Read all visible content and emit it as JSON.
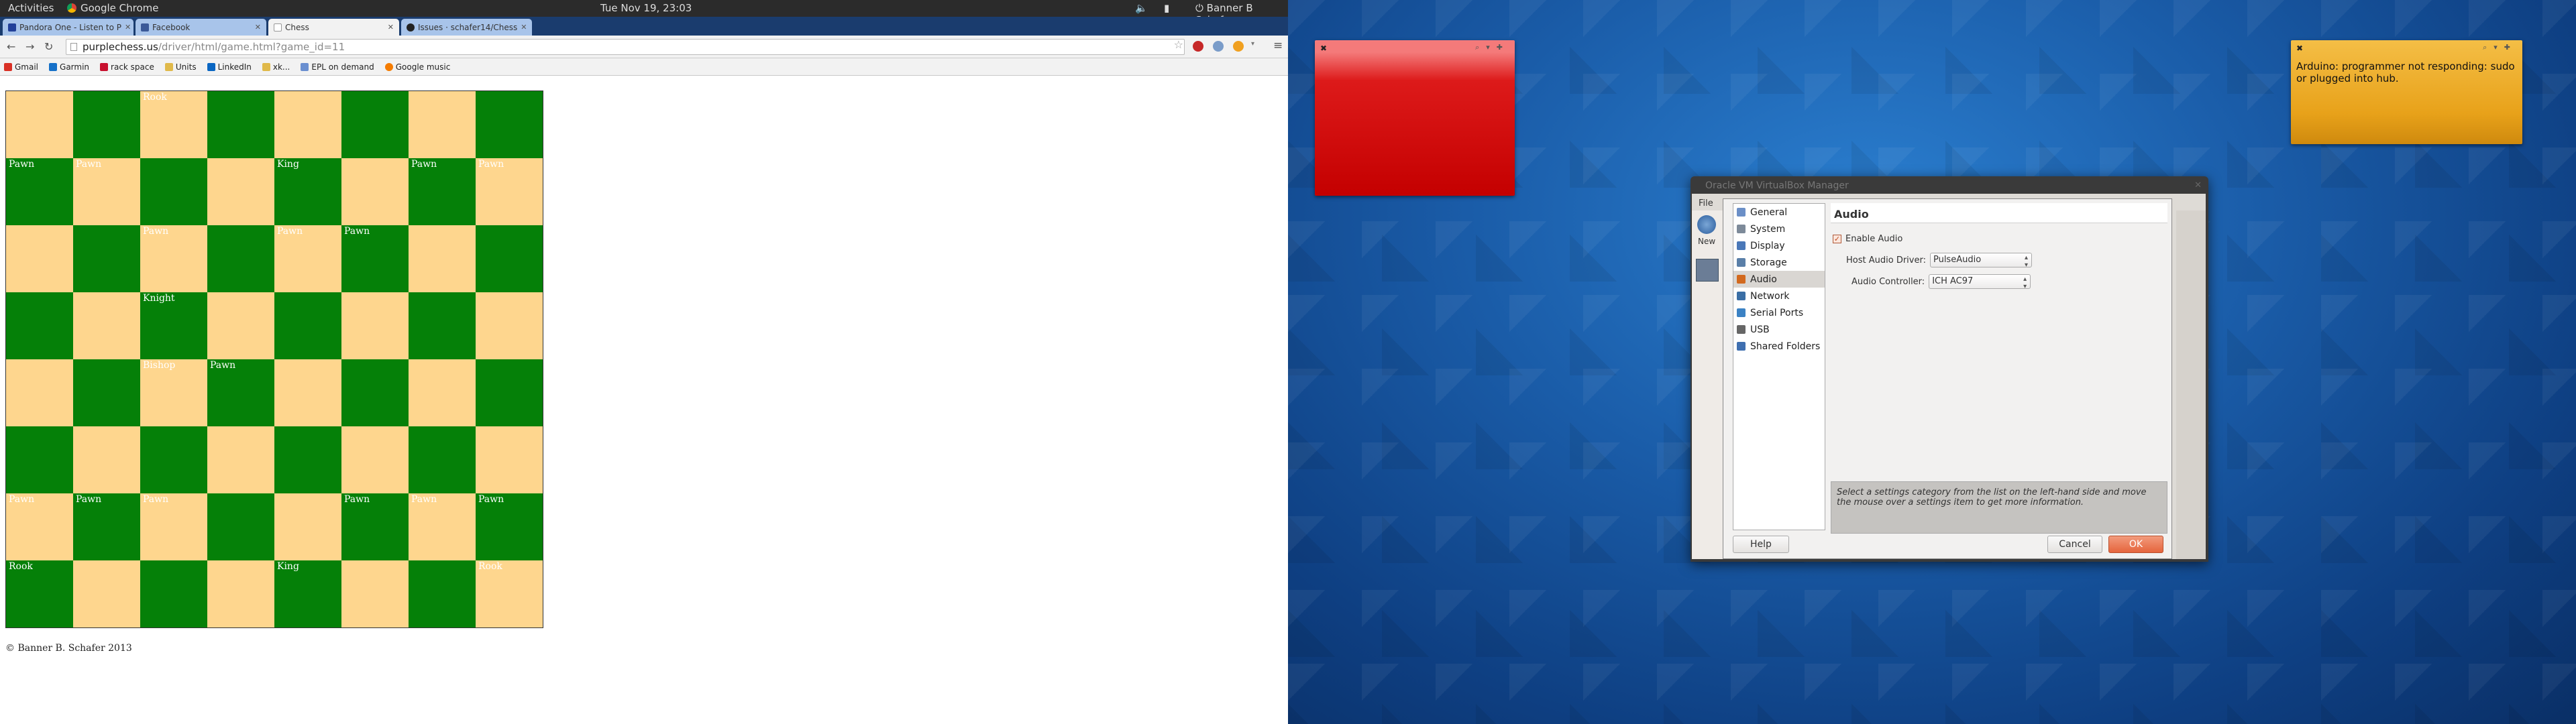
{
  "topbar": {
    "activities": "Activities",
    "app": "Google Chrome",
    "clock": "Tue Nov 19, 23:03",
    "user": "Banner B Schafer"
  },
  "tabs": [
    {
      "label": "Pandora One - Listen to P",
      "color": "#3b5998"
    },
    {
      "label": "Facebook",
      "color": "#3b5998"
    },
    {
      "label": "Chess",
      "color": "#ffffff"
    },
    {
      "label": "Issues · schafer14/Chess",
      "color": "#222222"
    }
  ],
  "url": {
    "domain": "purplechess.us",
    "path": "/driver/html/game.html?game_id=11"
  },
  "bookmarks": [
    {
      "label": "Gmail",
      "color": "#d93025"
    },
    {
      "label": "Garmin",
      "color": "#1570c8"
    },
    {
      "label": "rack space",
      "color": "#c8102e"
    },
    {
      "label": "Units",
      "color": "#e0b94a"
    },
    {
      "label": "LinkedIn",
      "color": "#0a66c2"
    },
    {
      "label": "xk...",
      "color": "#e0b94a"
    },
    {
      "label": "EPL on demand",
      "color": "#6a8fd0"
    },
    {
      "label": "Google music",
      "color": "#f57c00"
    }
  ],
  "board": {
    "rows": [
      [
        "",
        "",
        "Rook",
        "",
        "",
        "",
        "",
        ""
      ],
      [
        "Pawn",
        "Pawn",
        "",
        "",
        "King",
        "",
        "Pawn",
        "Pawn"
      ],
      [
        "",
        "",
        "Pawn",
        "",
        "Pawn",
        "Pawn",
        "",
        ""
      ],
      [
        "",
        "",
        "Knight",
        "",
        "",
        "",
        "",
        ""
      ],
      [
        "",
        "",
        "Bishop",
        "Pawn",
        "",
        "",
        "",
        ""
      ],
      [
        "",
        "",
        "",
        "",
        "",
        "",
        "",
        ""
      ],
      [
        "Pawn",
        "Pawn",
        "Pawn",
        "",
        "",
        "Pawn",
        "Pawn",
        "Pawn"
      ],
      [
        "Rook",
        "",
        "",
        "",
        "King",
        "",
        "",
        "Rook"
      ]
    ]
  },
  "copyright": "© Banner B. Schafer 2013",
  "notes": {
    "red": "",
    "orange": "Arduino: programmer not responding: sudo or plugged into hub."
  },
  "vbox": {
    "window_title": "Oracle VM VirtualBox Manager",
    "file_menu": "File",
    "new_label": "New",
    "categories": [
      {
        "label": "General",
        "color": "#6b8fc7"
      },
      {
        "label": "System",
        "color": "#7d8a99"
      },
      {
        "label": "Display",
        "color": "#4a78b8"
      },
      {
        "label": "Storage",
        "color": "#5a7fa8"
      },
      {
        "label": "Audio",
        "color": "#d2691e"
      },
      {
        "label": "Network",
        "color": "#3a6ea5"
      },
      {
        "label": "Serial Ports",
        "color": "#3b82c4"
      },
      {
        "label": "USB",
        "color": "#666666"
      },
      {
        "label": "Shared Folders",
        "color": "#3f6fb0"
      }
    ],
    "selected_category": "Audio",
    "panel_title": "Audio",
    "enable_audio": "Enable Audio",
    "host_driver_label": "Host Audio Driver:",
    "host_driver_value": "PulseAudio",
    "controller_label": "Audio Controller:",
    "controller_value": "ICH AC97",
    "info_text": "Select a settings category from the list on the left-hand side and move the mouse over a settings item to get more information.",
    "help": "Help",
    "cancel": "Cancel",
    "ok": "OK"
  }
}
